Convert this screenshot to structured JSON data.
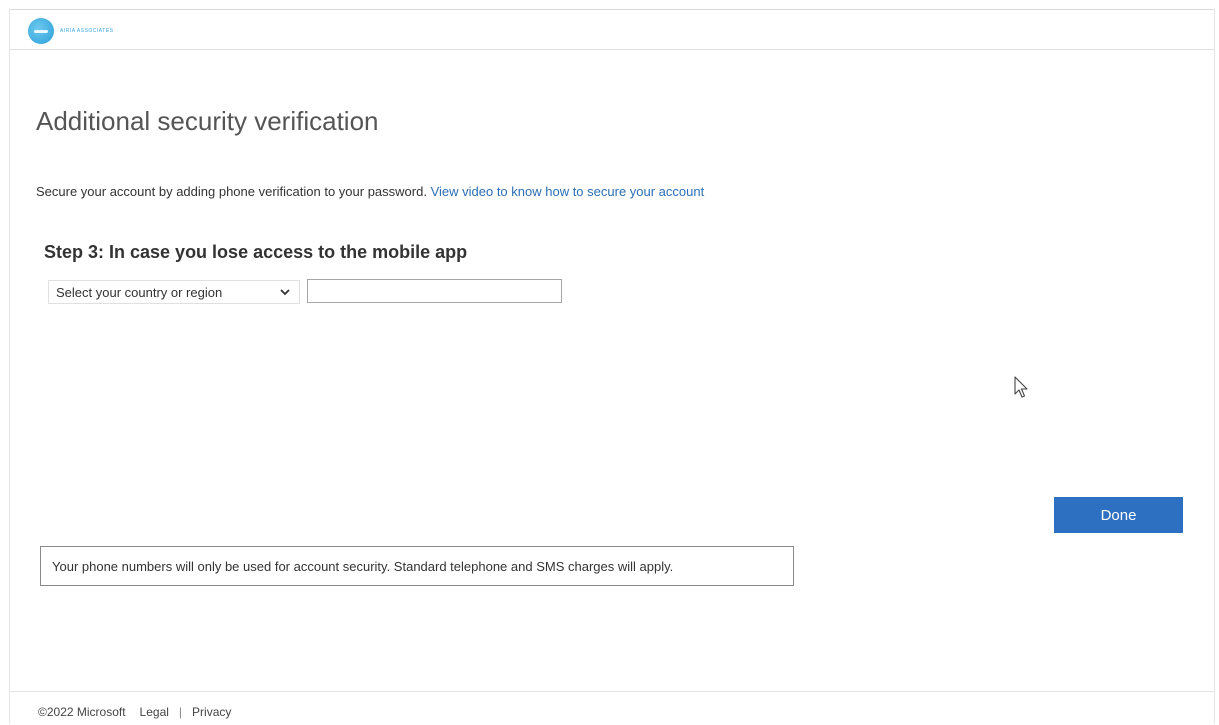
{
  "header": {
    "logo_text": "AIRIA ASSOCIATES"
  },
  "page": {
    "title": "Additional security verification",
    "intro_text": "Secure your account by adding phone verification to your password. ",
    "intro_link": "View video to know how to secure your account"
  },
  "step": {
    "heading": "Step 3: In case you lose access to the mobile app",
    "country_select": {
      "selected": "Select your country or region"
    },
    "phone_input": {
      "value": "",
      "placeholder": ""
    }
  },
  "actions": {
    "done_label": "Done"
  },
  "notice": {
    "text": "Your phone numbers will only be used for account security. Standard telephone and SMS charges will apply."
  },
  "footer": {
    "copyright": "©2022 Microsoft",
    "legal": "Legal",
    "separator": "|",
    "privacy": "Privacy"
  },
  "colors": {
    "accent": "#2d6fc0",
    "link": "#2c6fb6",
    "logo": "#3aa7dc"
  },
  "icons": {
    "logo": "logo-icon",
    "dropdown": "chevron-down-icon",
    "cursor": "mouse-pointer-icon"
  }
}
